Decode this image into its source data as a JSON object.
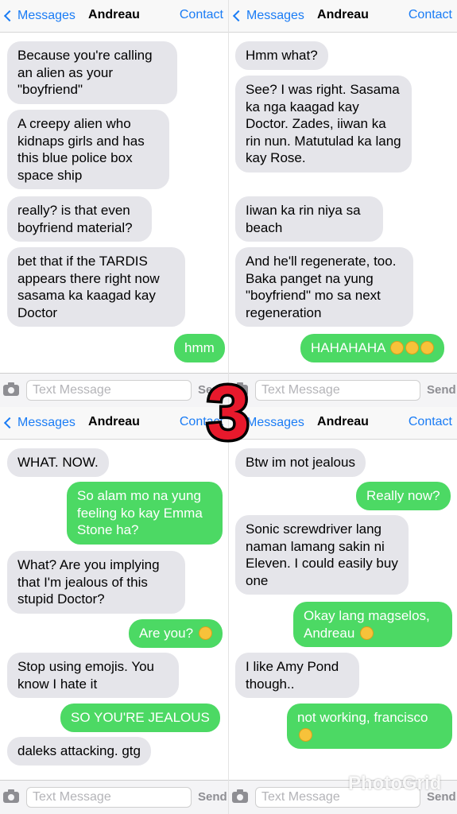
{
  "colors": {
    "accent": "#1a7cf5",
    "incoming": "#e5e5ea",
    "outgoing": "#4cd964",
    "number_red": "#e8192c"
  },
  "navbar": {
    "back_label": "Messages",
    "title": "Andreau",
    "contact_label": "Contact"
  },
  "inputbar": {
    "placeholder": "Text Message",
    "send_label": "Send",
    "camera_icon": "camera-icon"
  },
  "panels": {
    "top_left": {
      "messages": [
        {
          "dir": "in",
          "text": "Because you're calling an alien as your \"boyfriend\""
        },
        {
          "dir": "in",
          "text": "A creepy alien who kidnaps girls and has this blue police box space ship"
        },
        {
          "dir": "in",
          "text": "really? is that even boyfriend material?"
        },
        {
          "dir": "in",
          "text": "bet that if the TARDIS appears there right now sasama ka kaagad kay Doctor"
        },
        {
          "dir": "out",
          "text": "hmm"
        }
      ]
    },
    "top_right": {
      "messages": [
        {
          "dir": "in",
          "text": "Hmm what?"
        },
        {
          "dir": "in",
          "text": "See? I was right. Sasama ka nga kaagad kay Doctor. Zades, iiwan ka rin nun. Matutulad ka lang kay Rose."
        },
        {
          "dir": "in",
          "text": "Iiwan ka rin niya sa beach"
        },
        {
          "dir": "in",
          "text": "And he'll regenerate, too. Baka panget na yung \"boyfriend\" mo sa next regeneration"
        },
        {
          "dir": "out",
          "text": "HAHAHAHA",
          "emoji": "laughing-tears-emoji x3"
        }
      ]
    },
    "bottom_left": {
      "messages": [
        {
          "dir": "in",
          "text": "WHAT. NOW."
        },
        {
          "dir": "out",
          "text": "So alam mo na yung feeling ko kay Emma Stone ha?"
        },
        {
          "dir": "in",
          "text": "What? Are you implying that I'm jealous of this stupid Doctor?"
        },
        {
          "dir": "out",
          "text": "Are you?",
          "emoji": "winking-face-emoji"
        },
        {
          "dir": "in",
          "text": "Stop using emojis. You know I hate it"
        },
        {
          "dir": "out",
          "text": "SO YOU'RE JEALOUS"
        },
        {
          "dir": "in",
          "text": "daleks attacking. gtg"
        }
      ]
    },
    "bottom_right": {
      "messages": [
        {
          "dir": "in",
          "text": "Btw im not jealous"
        },
        {
          "dir": "out",
          "text": "Really now?"
        },
        {
          "dir": "in",
          "text": "Sonic screwdriver lang naman lamang sakin ni Eleven. I could easily buy one"
        },
        {
          "dir": "out",
          "text": "Okay lang magselos, Andreau",
          "emoji": "tongue-out-winking-emoji"
        },
        {
          "dir": "in",
          "text": "I like Amy Pond though.."
        },
        {
          "dir": "out",
          "text": "not working, francisco",
          "emoji": "winking-face-emoji"
        }
      ]
    }
  },
  "overlay": {
    "number": "3",
    "watermark": "PhotoGrid"
  }
}
